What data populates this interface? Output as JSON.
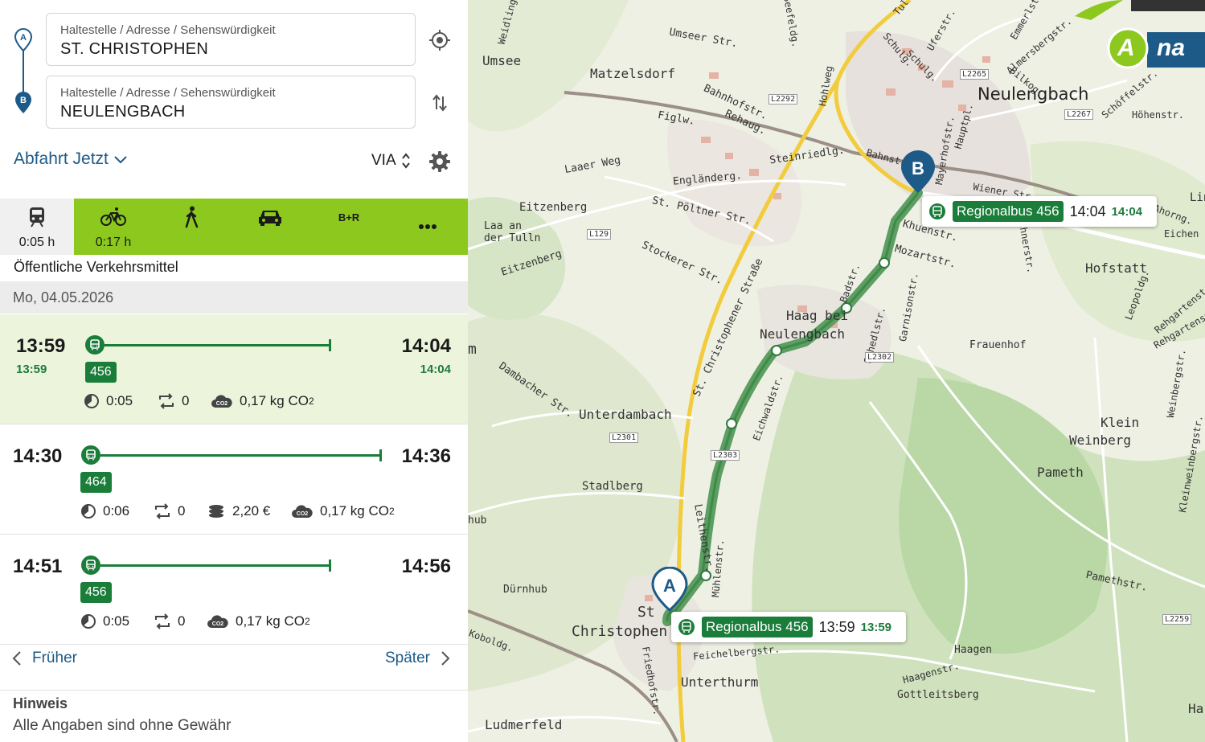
{
  "search": {
    "from": {
      "label": "Haltestelle / Adresse / Sehenswürdigkeit",
      "value": "ST. CHRISTOPHEN",
      "marker": "A"
    },
    "to": {
      "label": "Haltestelle / Adresse / Sehenswürdigkeit",
      "value": "NEULENGBACH",
      "marker": "B"
    },
    "departure_label": "Abfahrt Jetzt",
    "via_label": "VIA"
  },
  "modes": [
    {
      "name": "öffentliche-verkehrsmittel",
      "icon": "train-icon",
      "duration": "0:05 h",
      "active": true
    },
    {
      "name": "rad",
      "icon": "bicycle-icon",
      "duration": "0:17 h",
      "active": false
    },
    {
      "name": "fuss",
      "icon": "walking-icon",
      "duration": "",
      "active": false
    },
    {
      "name": "auto",
      "icon": "car-icon",
      "duration": "",
      "active": false
    },
    {
      "name": "bike-and-ride",
      "icon": "",
      "label": "B+R",
      "duration": "",
      "active": false
    },
    {
      "name": "mehr",
      "icon": "more-icon",
      "duration": "",
      "active": false
    }
  ],
  "mode_title": "Öffentliche Verkehrsmittel",
  "date": "Mo, 04.05.2026",
  "connections": [
    {
      "dep": "13:59",
      "dep_rt": "13:59",
      "arr": "14:04",
      "arr_rt": "14:04",
      "line": "456",
      "duration": "0:05",
      "changes": "0",
      "price": "",
      "co2": "0,17 kg CO",
      "co2_sub": "2",
      "selected": true
    },
    {
      "dep": "14:30",
      "dep_rt": "",
      "arr": "14:36",
      "arr_rt": "",
      "line": "464",
      "duration": "0:06",
      "changes": "0",
      "price": "2,20 €",
      "co2": "0,17 kg CO",
      "co2_sub": "2",
      "selected": false
    },
    {
      "dep": "14:51",
      "dep_rt": "",
      "arr": "14:56",
      "arr_rt": "",
      "line": "456",
      "duration": "0:05",
      "changes": "0",
      "price": "",
      "co2": "0,17 kg CO",
      "co2_sub": "2",
      "selected": false
    }
  ],
  "nav": {
    "earlier": "Früher",
    "later": "Später"
  },
  "hint": {
    "title": "Hinweis",
    "text": "Alle Angaben sind ohne Gewähr"
  },
  "map": {
    "popup_b": {
      "line": "Regionalbus 456",
      "time": "14:04",
      "rt": "14:04"
    },
    "popup_a": {
      "line": "Regionalbus 456",
      "time": "13:59",
      "rt": "13:59"
    },
    "marker_a": "A",
    "marker_b": "B",
    "logo_letter": "A",
    "logo_text": "na",
    "places": [
      "Umsee",
      "Matzelsdorf",
      "Neulengbach",
      "Hofstatt",
      "Eitzenberg",
      "Laa an",
      "der Tulln",
      "Haag bei",
      "Neulengbach",
      "Frauenhof",
      "Unterdambach",
      "Klein",
      "Weinberg",
      "Pameth",
      "Stadlberg",
      "Dürnhub",
      "St",
      "Christophen",
      "Unterthurm",
      "Haagen",
      "Gottleitsberg",
      "Ludmerfeld",
      "Höhenstr.",
      "Umseer Str.",
      "Bahnhofstr.",
      "Rehaug.",
      "Figlw.",
      "Laaer Weg",
      "Engländerg.",
      "St. Pöltner Str.",
      "Stockerer Str.",
      "Steinriedlg.",
      "St. Christophener Straße",
      "Eitzenberg",
      "Dambacher Str.",
      "Leithenstr.",
      "Pamethstr.",
      "Weinbergstr.",
      "Kleinweinbergstr.",
      "Rehgartenstr.",
      "Mozartstr.",
      "Khuenstr.",
      "Schulg.",
      "Hauptpl.",
      "Uferstr.",
      "Rehgartenstr.",
      "Eichwaldstr.",
      "Badstr.",
      "Garnisonstr.",
      "Schedlstr.",
      "Leopoldg.",
      "Ahorng.",
      "Eichen",
      "Feichelbergstr.",
      "Haagenstr.",
      "Friedhofstr.",
      "Mühlenstr.",
      "L2265",
      "L2267",
      "L2292",
      "L129",
      "L2302",
      "L2301",
      "L2303",
      "L2259",
      "Har",
      "Hohlweg",
      "Wiener Str.",
      "Lin",
      "m",
      "hub",
      "Weidling",
      "Seefeldg.",
      "Bahnstr.",
      "Mayerhofstr.",
      "Schulg.",
      "Almersbergstr.",
      "Bilkog.",
      "Schöffelstr.",
      "Emmerlstr.",
      "Leithnerstr.",
      "Tul",
      "Umseer Str.",
      "Koboldg."
    ]
  },
  "colors": {
    "accent_green": "#8cc81e",
    "transit_green": "#1a7d3a",
    "link_blue": "#1d5a86",
    "marker_blue": "#1e5a88"
  }
}
